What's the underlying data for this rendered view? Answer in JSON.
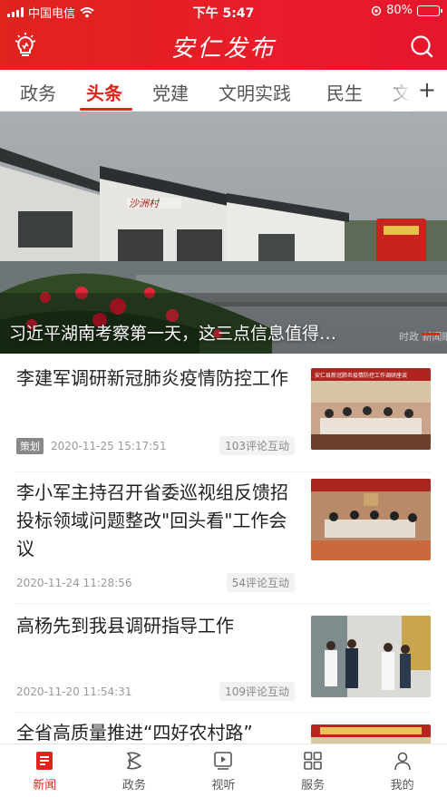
{
  "status_bar": {
    "carrier": "中国电信",
    "time": "下午 5:47",
    "battery": "80%",
    "battery_level": 0.8
  },
  "header": {
    "title": "安仁发布"
  },
  "tabs": {
    "items": [
      "政务",
      "头条",
      "党建",
      "文明实践",
      "民生",
      "文"
    ],
    "active": "头条",
    "add_icon": "plus-icon"
  },
  "hero": {
    "caption": "习近平湖南考察第一天，这三点信息值得…",
    "sign_text": "沙洲村",
    "watermark": "时政 新闻眼"
  },
  "news": [
    {
      "title": "李建军调研新冠肺炎疫情防控工作",
      "tag": "策划",
      "date": "2020-11-25 15:17:51",
      "comments": "103评论互动",
      "thumb_banner": "安仁县新冠肺炎疫情防控工作调研座谈"
    },
    {
      "title": "李小军主持召开省委巡视组反馈招投标领域问题整改\"回头看\"工作会议",
      "tag": "",
      "date": "2020-11-24 11:28:56",
      "comments": "54评论互动",
      "thumb_banner": ""
    },
    {
      "title": "高杨先到我县调研指导工作",
      "tag": "",
      "date": "2020-11-20 11:54:31",
      "comments": "109评论互动",
      "thumb_banner": ""
    },
    {
      "title": "全省高质量推进“四好农村路”",
      "tag": "",
      "date": "",
      "comments": "",
      "thumb_banner": ""
    }
  ],
  "bottom_nav": {
    "items": [
      {
        "label": "新闻",
        "icon": "news-icon"
      },
      {
        "label": "政务",
        "icon": "government-icon"
      },
      {
        "label": "视听",
        "icon": "video-icon"
      },
      {
        "label": "服务",
        "icon": "services-grid-icon"
      },
      {
        "label": "我的",
        "icon": "profile-icon"
      }
    ],
    "active": "新闻"
  },
  "colors": {
    "brand_red": "#e0231d",
    "text_primary": "#222222",
    "text_muted": "#999999"
  }
}
